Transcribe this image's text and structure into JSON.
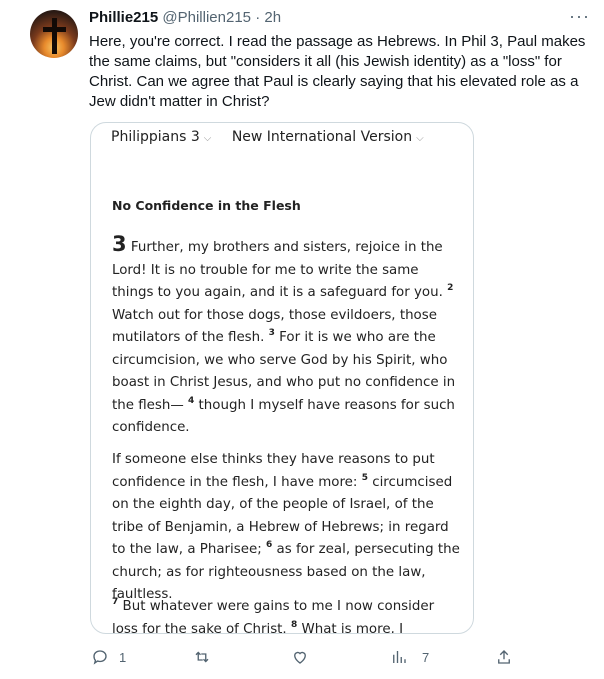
{
  "tweet": {
    "display_name": "Phillie215",
    "handle": "@Phillien215",
    "separator": "·",
    "time": "2h",
    "more": "···",
    "text": "Here, you're correct. I read the passage as Hebrews. In Phil 3, Paul makes the same claims, but \"considers it all (his Jewish identity) as a \"loss\" for Christ. Can we agree that Paul is clearly saying that his elevated role as a Jew didn't matter in Christ?"
  },
  "bible_card": {
    "book": "Philippians 3",
    "version": "New International Version",
    "section_title": "No Confidence in the Flesh",
    "p1": {
      "chapter": "3",
      "t1": " Further, my brothers and sisters, rejoice in the Lord! It is no trouble for me to write the same things to you again, and it is a safeguard for you. ",
      "v2": "2",
      "t2": " Watch out for those dogs, those evildoers, those mutilators of the flesh. ",
      "v3": "3",
      "t3": " For it is we who are the circumcision, we who serve God by his Spirit, who boast in Christ Jesus, and who put no confidence in the flesh— ",
      "v4": "4",
      "t4": " though I myself have reasons for such confidence."
    },
    "p2": {
      "t1": "If someone else thinks they have reasons to put confidence in the flesh, I have more: ",
      "v5": "5",
      "t2": " circumcised on the eighth day, of the people of Israel, of the tribe of Benjamin, a Hebrew of Hebrews; in regard to the law, a Pharisee; ",
      "v6": "6",
      "t3": " as for zeal, persecuting the church; as for righteousness based on the law, faultless."
    },
    "p3": {
      "v7": "7",
      "t1": " But whatever were gains to me I now consider loss for the sake of Christ. ",
      "v8": "8",
      "t2": " What is more, I consider"
    }
  },
  "actions": {
    "reply_count": "1",
    "retweet_count": "",
    "like_count": "",
    "views_count": "7"
  },
  "icons": [
    "cross-avatar",
    "more-icon",
    "reply-icon",
    "retweet-icon",
    "like-icon",
    "views-icon",
    "share-icon",
    "chevron-down-icon"
  ]
}
